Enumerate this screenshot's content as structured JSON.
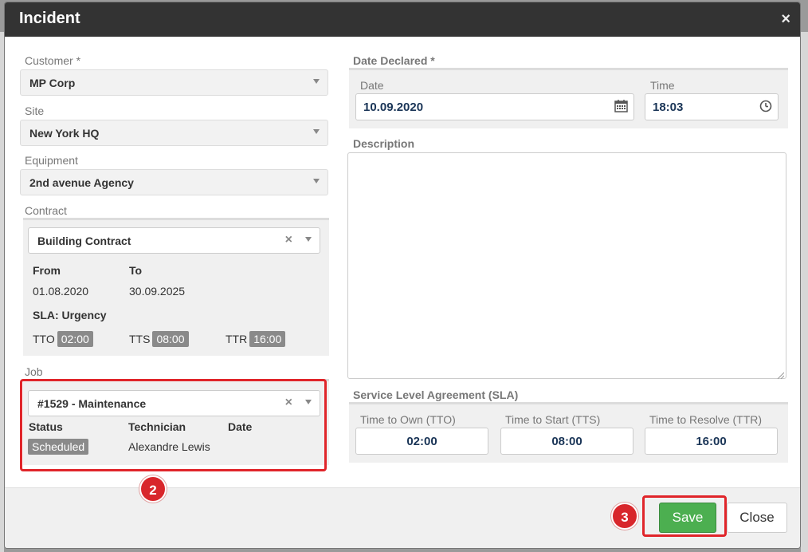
{
  "modal": {
    "title": "Incident",
    "close_glyph": "×"
  },
  "customer": {
    "label": "Customer *",
    "value": "MP Corp"
  },
  "site": {
    "label": "Site",
    "value": "New York HQ"
  },
  "equipment": {
    "label": "Equipment",
    "value": "2nd avenue Agency"
  },
  "contract": {
    "label": "Contract",
    "value": "Building Contract",
    "from_label": "From",
    "to_label": "To",
    "from_value": "01.08.2020",
    "to_value": "30.09.2025",
    "sla_title": "SLA: Urgency",
    "tto_label": "TTO",
    "tto_value": "02:00",
    "tts_label": "TTS",
    "tts_value": "08:00",
    "ttr_label": "TTR",
    "ttr_value": "16:00"
  },
  "job": {
    "label": "Job",
    "value": "#1529 - Maintenance",
    "status_label": "Status",
    "technician_label": "Technician",
    "date_label": "Date",
    "status_value": "Scheduled",
    "technician_value": "Alexandre Lewis"
  },
  "date_declared": {
    "label": "Date Declared *",
    "date_label": "Date",
    "date_value": "10.09.2020",
    "time_label": "Time",
    "time_value": "18:03"
  },
  "description": {
    "label": "Description"
  },
  "sla": {
    "label": "Service Level Agreement (SLA)",
    "tto_label": "Time to Own (TTO)",
    "tto_value": "02:00",
    "tts_label": "Time to Start (TTS)",
    "tts_value": "08:00",
    "ttr_label": "Time to Resolve (TTR)",
    "ttr_value": "16:00"
  },
  "annotations": {
    "marker_2": "2",
    "marker_3": "3"
  },
  "footer": {
    "save_label": "Save",
    "close_label": "Close"
  },
  "icons": {
    "date": "calendar-icon",
    "time": "clock-icon"
  }
}
